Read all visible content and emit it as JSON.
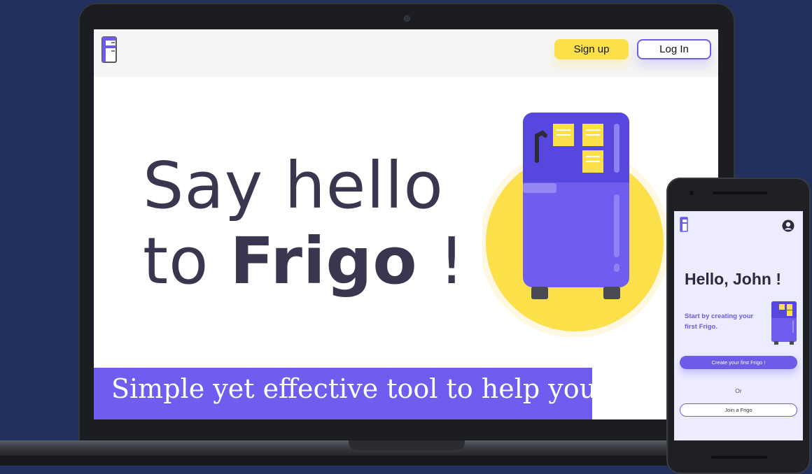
{
  "colors": {
    "background": "#22305e",
    "brand_purple": "#6c5ce7",
    "brand_yellow": "#fbe04a",
    "hero_text": "#3b3650"
  },
  "laptop": {
    "header": {
      "logo_icon": "fridge-logo-icon",
      "signup_label": "Sign up",
      "login_label": "Log In"
    },
    "hero": {
      "line1": "Say hello",
      "line2_prefix": "to ",
      "line2_brand": "Frigo",
      "line2_suffix": " !",
      "illustration": "fridge-with-sticky-notes-icon"
    },
    "tagline": "Simple yet effective tool to help you"
  },
  "phone": {
    "logo_icon": "fridge-logo-icon",
    "avatar_icon": "user-avatar-icon",
    "greeting": "Hello, John !",
    "prompt": "Start by creating your first Frigo.",
    "create_button": "Create your first Frigo !",
    "or_text": "Or",
    "join_button": "Join a Frigo"
  }
}
